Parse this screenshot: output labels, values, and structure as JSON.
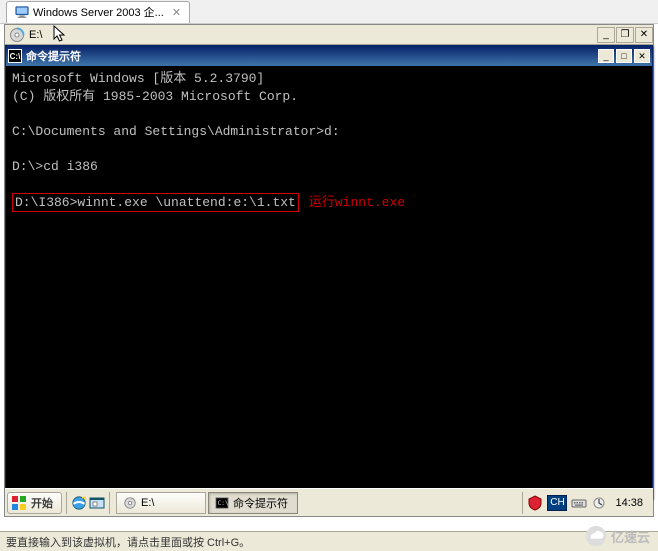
{
  "vm_tab": {
    "label": "Windows Server 2003 企..."
  },
  "address_strip": {
    "text": "E:\\"
  },
  "cmd": {
    "title": "命令提示符",
    "lines": {
      "l1": "Microsoft Windows [版本 5.2.3790]",
      "l2": "(C) 版权所有 1985-2003 Microsoft Corp.",
      "l3": "C:\\Documents and Settings\\Administrator>d:",
      "l4": "D:\\>cd i386",
      "l5_prompt": "D:\\I386>",
      "l5_cmd": "winnt.exe \\unattend:e:\\1.txt",
      "annotation": "运行winnt.exe"
    }
  },
  "taskbar": {
    "start": "开始",
    "task_explorer": "E:\\",
    "task_cmd": "命令提示符",
    "ime": "CH",
    "clock": "14:38"
  },
  "status": {
    "text": "要直接输入到该虚拟机，请点击里面或按 Ctrl+G。"
  },
  "watermark": {
    "text": "亿速云"
  }
}
